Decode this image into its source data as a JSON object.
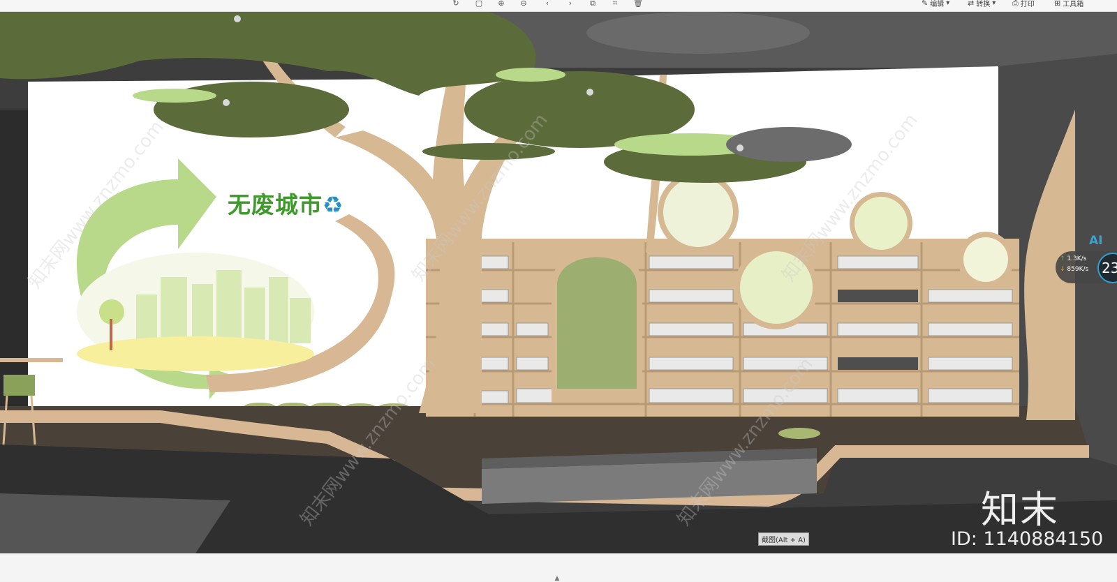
{
  "toolbar": {
    "icons": [
      "rotate-icon",
      "fit-icon",
      "zoom-in-icon",
      "zoom-out-icon",
      "prev-icon",
      "next-icon",
      "copy-icon",
      "crop-icon",
      "delete-icon"
    ],
    "edit_label": "编辑",
    "convert_label": "转换",
    "print_label": "打印",
    "toolbox_label": "工具箱"
  },
  "scene": {
    "wall_title": "无废城市",
    "wall_title_icon": "recycle-icon",
    "colors": {
      "canopy": "#5b6b3a",
      "wall": "#ffffff",
      "wood": "#d6b892",
      "floor_dark": "#3a3a3a",
      "arrow_green": "#b8d98a",
      "title_green": "#3f9a2c"
    }
  },
  "net_widget": {
    "ai_label": "AI",
    "upload": "1.3K/s",
    "download": "859K/s",
    "number": "23"
  },
  "watermark": {
    "logo": "知末",
    "id_text": "ID: 1140884150",
    "diagonal_text": "知末网www.znzmo.com"
  },
  "screenshot_tip": "截图(Alt + A)"
}
